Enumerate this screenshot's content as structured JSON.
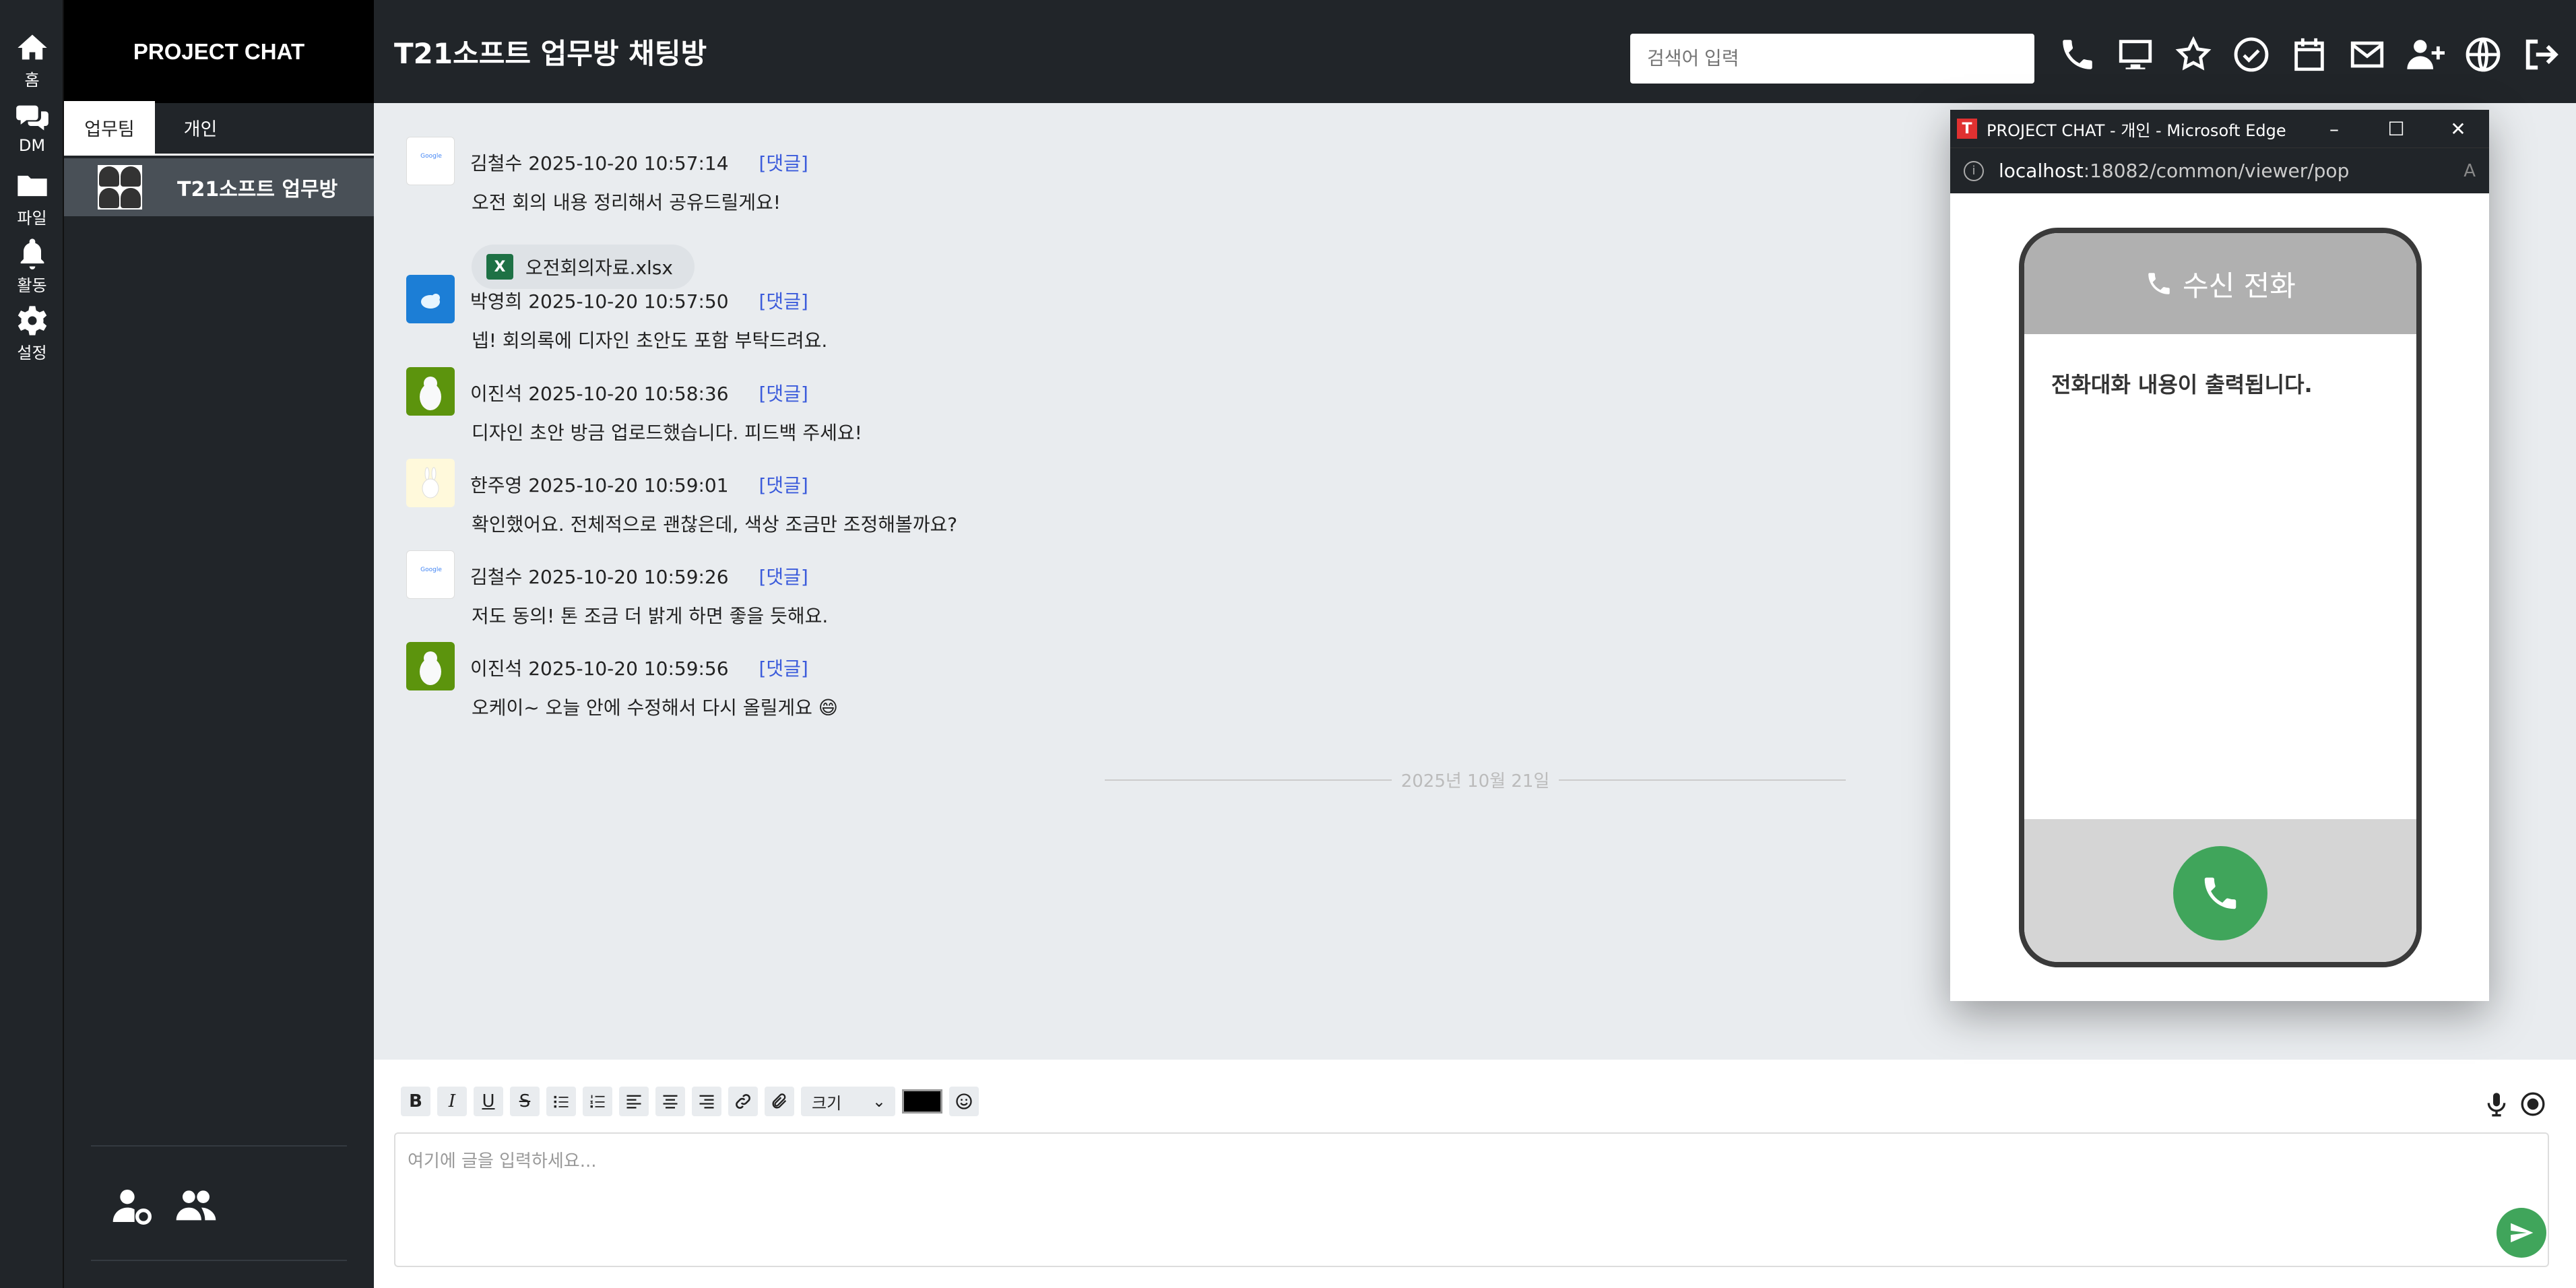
{
  "nav": {
    "home": "홈",
    "dm": "DM",
    "files": "파일",
    "activity": "활동",
    "settings": "설정"
  },
  "sidebar": {
    "brand": "PROJECT CHAT",
    "tabs": [
      "업무팀",
      "개인"
    ],
    "rooms": [
      "T21소프트 업무방"
    ]
  },
  "header": {
    "title": "T21소프트 업무방 채팅방",
    "search_placeholder": "검색어 입력"
  },
  "messages": [
    {
      "author": "김철수",
      "time": "2025-10-20 10:57:14",
      "reply": "[댓글]",
      "text": "오전 회의 내용 정리해서 공유드릴게요!",
      "file": "오전회의자료.xlsx",
      "file_badge": "X"
    },
    {
      "author": "박영희",
      "time": "2025-10-20 10:57:50",
      "reply": "[댓글]",
      "text": "넵! 회의록에 디자인 초안도 포함 부탁드려요."
    },
    {
      "author": "이진석",
      "time": "2025-10-20 10:58:36",
      "reply": "[댓글]",
      "text": " 디자인 초안 방금 업로드했습니다. 피드백 주세요!"
    },
    {
      "author": "한주영",
      "time": "2025-10-20 10:59:01",
      "reply": "[댓글]",
      "text": "확인했어요. 전체적으로 괜찮은데, 색상 조금만 조정해볼까요?"
    },
    {
      "author": "김철수",
      "time": "2025-10-20 10:59:26",
      "reply": "[댓글]",
      "text": "저도 동의! 톤 조금 더 밝게 하면 좋을 듯해요."
    },
    {
      "author": "이진석",
      "time": "2025-10-20 10:59:56",
      "reply": "[댓글]",
      "text": "오케이~ 오늘 안에 수정해서 다시 올릴게요 😄"
    }
  ],
  "date_divider": "2025년 10월 21일",
  "composer": {
    "size_label": "크기",
    "placeholder": "여기에 글을 입력하세요...",
    "color": "#000000"
  },
  "popup": {
    "window_title": "PROJECT CHAT - 개인 - Microsoft Edge",
    "logo": "T",
    "url_host": "localhost",
    "url_path": ":18082/common/viewer/pop",
    "call_title": "수신 전화",
    "call_body": "전화대화 내용이 출력됩니다."
  },
  "colors": {
    "accent_green": "#40a55b",
    "link_blue": "#3b5bdb",
    "dark": "#212529"
  }
}
